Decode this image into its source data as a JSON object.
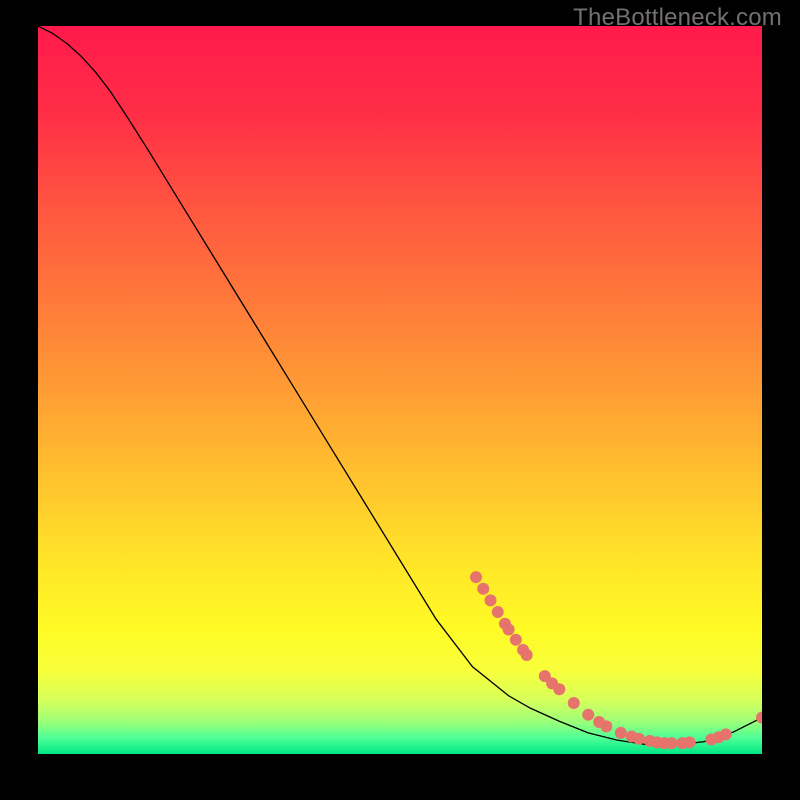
{
  "watermark": "TheBottleneck.com",
  "chart_data": {
    "type": "line",
    "title": "",
    "xlabel": "",
    "ylabel": "",
    "xlim": [
      0,
      100
    ],
    "ylim": [
      0,
      100
    ],
    "gradient_stops": [
      {
        "offset": 0.0,
        "color": "#ff1a4b"
      },
      {
        "offset": 0.12,
        "color": "#ff2e46"
      },
      {
        "offset": 0.25,
        "color": "#ff5640"
      },
      {
        "offset": 0.38,
        "color": "#ff7a3a"
      },
      {
        "offset": 0.5,
        "color": "#ff9c34"
      },
      {
        "offset": 0.62,
        "color": "#ffc22e"
      },
      {
        "offset": 0.74,
        "color": "#ffe628"
      },
      {
        "offset": 0.83,
        "color": "#fffb26"
      },
      {
        "offset": 0.885,
        "color": "#f8ff3a"
      },
      {
        "offset": 0.925,
        "color": "#d8ff5a"
      },
      {
        "offset": 0.955,
        "color": "#9eff78"
      },
      {
        "offset": 0.978,
        "color": "#4eff96"
      },
      {
        "offset": 1.0,
        "color": "#00e786"
      }
    ],
    "curve": [
      {
        "x": 0,
        "y": 100.0
      },
      {
        "x": 2,
        "y": 99.0
      },
      {
        "x": 4,
        "y": 97.6
      },
      {
        "x": 6,
        "y": 95.8
      },
      {
        "x": 8,
        "y": 93.6
      },
      {
        "x": 10,
        "y": 91.0
      },
      {
        "x": 12,
        "y": 88.0
      },
      {
        "x": 15,
        "y": 83.3
      },
      {
        "x": 20,
        "y": 75.2
      },
      {
        "x": 25,
        "y": 67.1
      },
      {
        "x": 30,
        "y": 59.0
      },
      {
        "x": 35,
        "y": 50.9
      },
      {
        "x": 40,
        "y": 42.8
      },
      {
        "x": 45,
        "y": 34.7
      },
      {
        "x": 50,
        "y": 26.6
      },
      {
        "x": 55,
        "y": 18.5
      },
      {
        "x": 60,
        "y": 12.0
      },
      {
        "x": 65,
        "y": 8.0
      },
      {
        "x": 68,
        "y": 6.3
      },
      {
        "x": 72,
        "y": 4.5
      },
      {
        "x": 76,
        "y": 2.9
      },
      {
        "x": 80,
        "y": 1.9
      },
      {
        "x": 84,
        "y": 1.3
      },
      {
        "x": 88,
        "y": 1.2
      },
      {
        "x": 92,
        "y": 1.7
      },
      {
        "x": 96,
        "y": 3.0
      },
      {
        "x": 100,
        "y": 5.0
      }
    ],
    "datapoints": [
      {
        "x": 60.5,
        "y": 24.3
      },
      {
        "x": 61.5,
        "y": 22.7
      },
      {
        "x": 62.5,
        "y": 21.1
      },
      {
        "x": 63.5,
        "y": 19.5
      },
      {
        "x": 64.5,
        "y": 17.9
      },
      {
        "x": 65.0,
        "y": 17.1
      },
      {
        "x": 66.0,
        "y": 15.7
      },
      {
        "x": 67.0,
        "y": 14.3
      },
      {
        "x": 67.5,
        "y": 13.6
      },
      {
        "x": 70.0,
        "y": 10.7
      },
      {
        "x": 71.0,
        "y": 9.7
      },
      {
        "x": 72.0,
        "y": 8.9
      },
      {
        "x": 74.0,
        "y": 7.0
      },
      {
        "x": 76.0,
        "y": 5.4
      },
      {
        "x": 77.5,
        "y": 4.4
      },
      {
        "x": 78.5,
        "y": 3.8
      },
      {
        "x": 80.5,
        "y": 2.9
      },
      {
        "x": 82.0,
        "y": 2.4
      },
      {
        "x": 83.0,
        "y": 2.1
      },
      {
        "x": 84.5,
        "y": 1.8
      },
      {
        "x": 85.5,
        "y": 1.6
      },
      {
        "x": 86.5,
        "y": 1.5
      },
      {
        "x": 87.5,
        "y": 1.5
      },
      {
        "x": 89.0,
        "y": 1.5
      },
      {
        "x": 90.0,
        "y": 1.6
      },
      {
        "x": 93.0,
        "y": 2.0
      },
      {
        "x": 94.0,
        "y": 2.3
      },
      {
        "x": 95.0,
        "y": 2.7
      },
      {
        "x": 100.0,
        "y": 5.0
      }
    ],
    "marker": {
      "color": "#e6746c",
      "radius_px": 6
    }
  }
}
